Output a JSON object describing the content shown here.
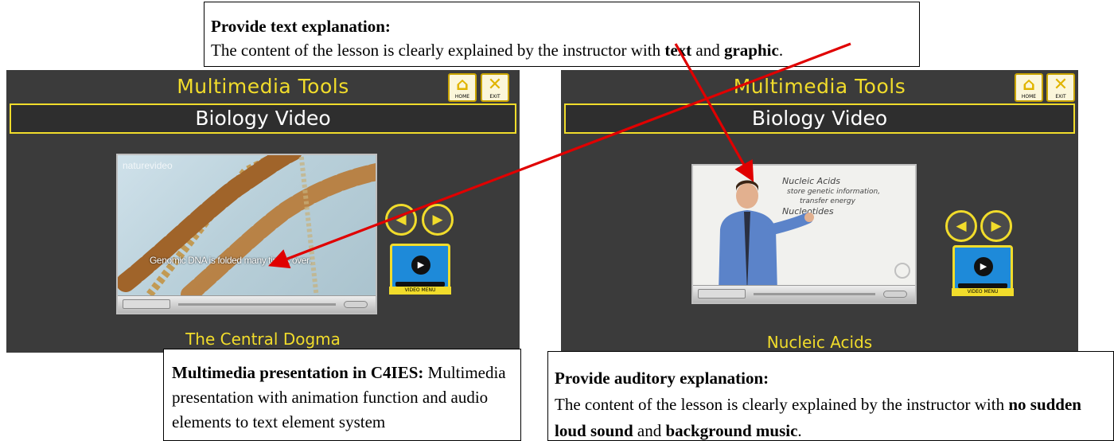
{
  "callout_top": {
    "heading": "Provide text explanation:",
    "line_prefix": "The content of the lesson is clearly explained by the instructor with ",
    "bold_1": "text",
    "mid": " and ",
    "bold_2": "graphic",
    "end": "."
  },
  "callout_left": {
    "heading": "Multimedia presentation in C4IES:",
    "body": " Multimedia presentation with animation function and audio elements to text element system"
  },
  "callout_right": {
    "heading": "Provide auditory explanation:",
    "line_prefix": "The content of the lesson is clearly explained by the instructor with ",
    "bold_1": "no sudden loud sound",
    "mid": " and ",
    "bold_2": "background music",
    "end": "."
  },
  "panel_left": {
    "title": "Multimedia Tools",
    "subtitle": "Biology Video",
    "home_caption": "HOME",
    "exit_caption": "EXIT",
    "video_watermark": "naturevideo",
    "video_subtitle": "Genomic DNA is folded many times over.",
    "video_menu_label": "VIDEO MENU",
    "caption": "The Central Dogma"
  },
  "panel_right": {
    "title": "Multimedia Tools",
    "subtitle": "Biology Video",
    "home_caption": "HOME",
    "exit_caption": "EXIT",
    "board_lines": [
      "Nucleic Acids",
      "store genetic information,",
      "transfer energy",
      "Nucleotides"
    ],
    "video_menu_label": "VIDEO MENU",
    "caption": "Nucleic Acids"
  },
  "colors": {
    "panel_bg": "#3b3b3b",
    "accent_yellow": "#f1dc2b",
    "arrow_red": "#e00000",
    "video_menu_blue": "#1e8ad9"
  },
  "icons": [
    "home-icon",
    "exit-icon",
    "prev-icon",
    "next-icon",
    "play-icon"
  ]
}
